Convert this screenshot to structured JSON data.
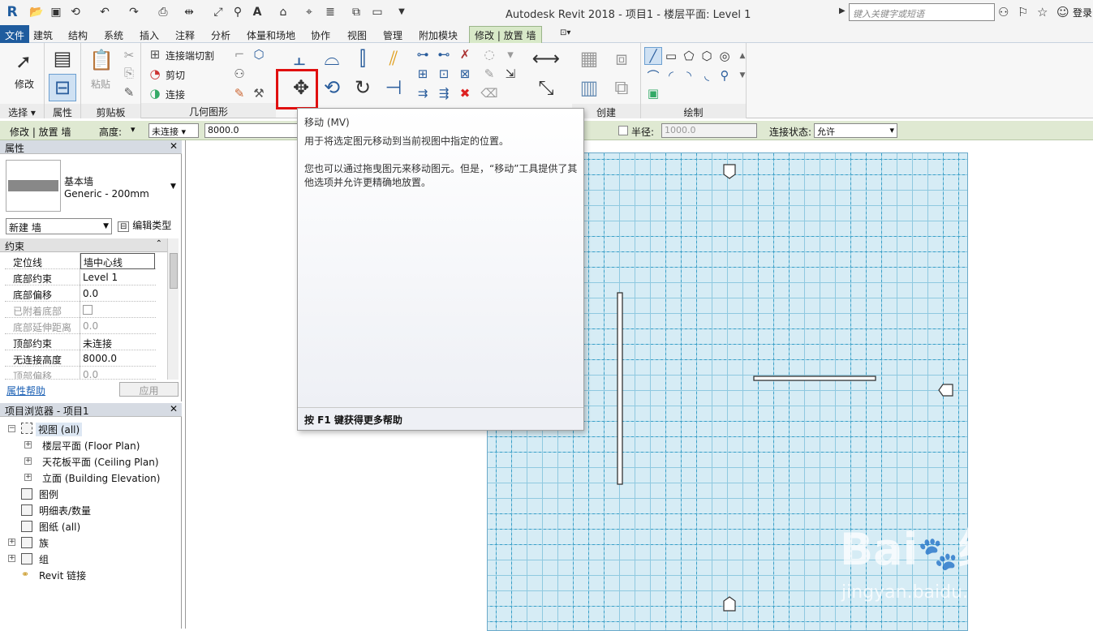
{
  "app": {
    "title": "Autodesk Revit 2018 -     项目1 - 楼层平面: Level 1",
    "logo": "R"
  },
  "search": {
    "placeholder": "键入关键字或短语"
  },
  "login": "登录",
  "menu": {
    "file": "文件",
    "tabs": [
      "建筑",
      "结构",
      "系统",
      "插入",
      "注释",
      "分析",
      "体量和场地",
      "协作",
      "视图",
      "管理",
      "附加模块"
    ],
    "active": "修改 | 放置 墙"
  },
  "ribbon": {
    "select_label": "选择",
    "modify": "修改",
    "properties_label": "属性",
    "clipboard_label": "剪贴板",
    "paste": "粘贴",
    "join_cut": "连接端切割",
    "cut": "剪切",
    "join": "连接",
    "geometry_label": "几何图形",
    "create_label": "创建",
    "draw_label": "绘制"
  },
  "options": {
    "context": "修改 | 放置 墙",
    "height_label": "高度:",
    "unconnected": "未连接",
    "height_value": "8000.0",
    "radius_label": "半径:",
    "radius_value": "1000.0",
    "join_status_label": "连接状态:",
    "join_status": "允许"
  },
  "properties": {
    "title": "属性",
    "type_family": "基本墙",
    "type_name": "Generic - 200mm",
    "new_wall": "新建 墙",
    "edit_type": "编辑类型",
    "section": "约束",
    "rows": [
      {
        "k": "定位线",
        "v": "墙中心线"
      },
      {
        "k": "底部约束",
        "v": "Level 1"
      },
      {
        "k": "底部偏移",
        "v": "0.0"
      },
      {
        "k": "已附着底部",
        "v": ""
      },
      {
        "k": "底部延伸距离",
        "v": "0.0"
      },
      {
        "k": "顶部约束",
        "v": "未连接"
      },
      {
        "k": "无连接高度",
        "v": "8000.0"
      },
      {
        "k": "顶部偏移",
        "v": "0.0"
      }
    ],
    "help": "属性帮助",
    "apply": "应用"
  },
  "browser": {
    "title": "项目浏览器 - 项目1",
    "nodes": [
      "视图 (all)",
      "楼层平面 (Floor Plan)",
      "天花板平面 (Ceiling Plan)",
      "立面 (Building Elevation)",
      "图例",
      "明细表/数量",
      "图纸 (all)",
      "族",
      "组",
      "Revit 链接"
    ]
  },
  "tooltip": {
    "title": "移动 (MV)",
    "line1": "用于将选定图元移动到当前视图中指定的位置。",
    "line2": "您也可以通过拖曳图元来移动图元。但是，“移动”工具提供了其他选项并允许更精确地放置。",
    "footer": "按 F1 键获得更多帮助"
  },
  "watermark": {
    "brand": "Bai",
    "site": "经验",
    "url": "jingyan.baidu.com"
  }
}
